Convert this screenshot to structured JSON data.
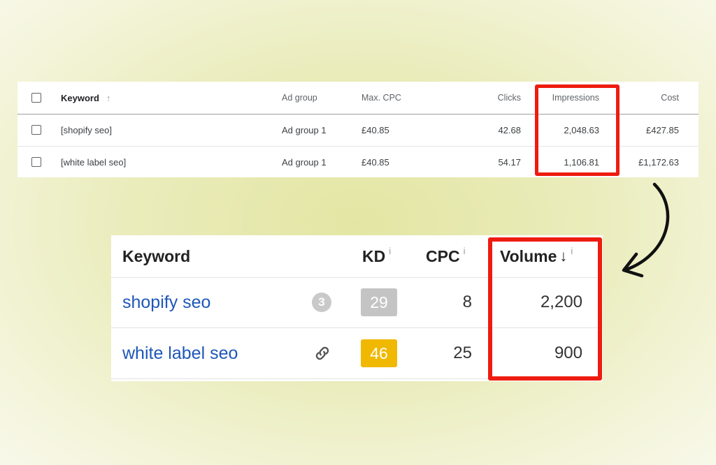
{
  "ads_table": {
    "header": {
      "keyword": "Keyword",
      "sort_icon": "sort-up-arrow-icon",
      "ad_group": "Ad group",
      "max_cpc": "Max. CPC",
      "clicks": "Clicks",
      "impressions": "Impressions",
      "cost": "Cost"
    },
    "rows": [
      {
        "keyword": "[shopify seo]",
        "ad_group": "Ad group 1",
        "max_cpc": "£40.85",
        "clicks": "42.68",
        "impressions": "2,048.63",
        "cost": "£427.85"
      },
      {
        "keyword": "[white label seo]",
        "ad_group": "Ad group 1",
        "max_cpc": "£40.85",
        "clicks": "54.17",
        "impressions": "1,106.81",
        "cost": "£1,172.63"
      }
    ]
  },
  "ahrefs_table": {
    "header": {
      "keyword": "Keyword",
      "kd": "KD",
      "cpc": "CPC",
      "volume": "Volume",
      "info_glyph": "i",
      "sort_icon": "sort-down-arrow-icon"
    },
    "rows": [
      {
        "keyword": "shopify seo",
        "badge": "3",
        "kd": "29",
        "kd_color": "#c4c4c4",
        "cpc": "8",
        "volume": "2,200"
      },
      {
        "keyword": "white label seo",
        "badge_icon": "link-icon",
        "kd": "46",
        "kd_color": "#f0b800",
        "cpc": "25",
        "volume": "900"
      }
    ]
  },
  "colors": {
    "highlight": "#ee1c10",
    "link": "#1f57b8",
    "arrow": "#111111"
  }
}
